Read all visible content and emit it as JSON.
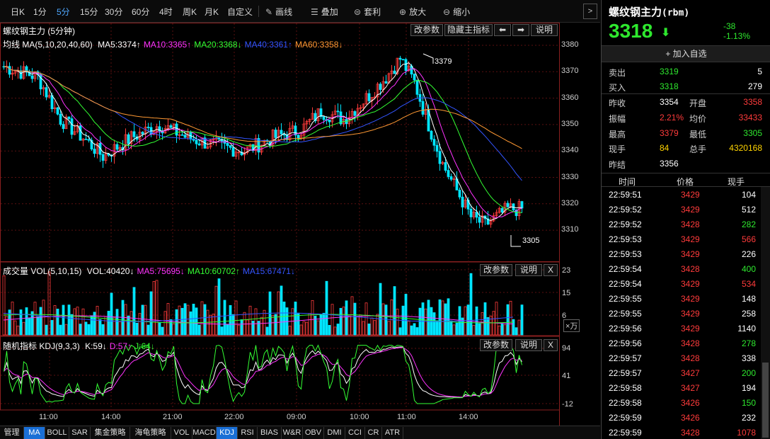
{
  "toolbar": {
    "periods": [
      "日K",
      "1分",
      "5分",
      "15分",
      "30分",
      "60分",
      "4时",
      "周K",
      "月K",
      "自定义"
    ],
    "active_period": "5分",
    "tools": [
      {
        "icon": "pencil-icon",
        "label": "画线"
      },
      {
        "icon": "stack-icon",
        "label": "叠加"
      },
      {
        "icon": "arbitrage-icon",
        "label": "套利"
      },
      {
        "icon": "zoom-in-icon",
        "label": "放大"
      },
      {
        "icon": "zoom-out-icon",
        "label": "缩小"
      }
    ],
    "next_glyph": ">"
  },
  "main_chart": {
    "title": "螺纹钢主力 (5分钟)",
    "buttons": {
      "params": "改参数",
      "hide": "隐藏主指标",
      "left": "⬅",
      "right": "➡",
      "help": "说明"
    },
    "legend": {
      "prefix": "均线",
      "name": "MA(5,10,20,40,60)",
      "items": [
        {
          "text": "MA5:3374↑",
          "color": "#ffffff"
        },
        {
          "text": "MA10:3365↑",
          "color": "#ff33ff"
        },
        {
          "text": "MA20:3368↓",
          "color": "#33ff33"
        },
        {
          "text": "MA40:3361↑",
          "color": "#3355ff"
        },
        {
          "text": "MA60:3358↓",
          "color": "#ff9933"
        }
      ]
    },
    "y_ticks": [
      "3380",
      "3370",
      "3360",
      "3350",
      "3340",
      "3330",
      "3320",
      "3310"
    ],
    "high_mark": "3379",
    "low_mark": "3305"
  },
  "vol_chart": {
    "name": "成交量",
    "params": "VOL(5,10,15)",
    "items": [
      {
        "text": "VOL:40420↓",
        "color": "#ffffff"
      },
      {
        "text": "MA5:75695↓",
        "color": "#ff33ff"
      },
      {
        "text": "MA10:60702↑",
        "color": "#33ff33"
      },
      {
        "text": "MA15:67471↓",
        "color": "#3355ff"
      }
    ],
    "buttons": {
      "params": "改参数",
      "help": "说明",
      "close": "X"
    },
    "y_ticks": [
      "23",
      "15",
      "6"
    ],
    "unit": "×万"
  },
  "kdj_chart": {
    "name": "随机指标",
    "params": "KDJ(9,3,3)",
    "items": [
      {
        "text": "K:59↓",
        "color": "#ffffff"
      },
      {
        "text": "D:57↑",
        "color": "#ff33ff"
      },
      {
        "text": "J:64↓",
        "color": "#33ff33"
      }
    ],
    "buttons": {
      "params": "改参数",
      "help": "说明",
      "close": "X"
    },
    "y_ticks": [
      "94",
      "41",
      "-12"
    ]
  },
  "x_ticks": [
    "11:00",
    "14:00",
    "21:00",
    "22:00",
    "09:00",
    "10:00",
    "11:00",
    "14:00"
  ],
  "tabs": [
    "管理",
    "MA",
    "BOLL",
    "SAR",
    "集金策略",
    "海龟策略",
    "VOL",
    "MACD",
    "KDJ",
    "RSI",
    "BIAS",
    "W&R",
    "OBV",
    "DMI",
    "CCI",
    "CR",
    "ATR"
  ],
  "active_tabs": [
    "MA",
    "KDJ"
  ],
  "quote": {
    "name": "螺纹钢主力",
    "code": "(rbm)",
    "price": "3318",
    "arrow": "⬇",
    "change": "-38",
    "change_pct": "-1.13%",
    "watch_label": "加入自选",
    "sell_label": "卖出",
    "sell_price": "3319",
    "sell_vol": "5",
    "buy_label": "买入",
    "buy_price": "3318",
    "buy_vol": "279",
    "stats": [
      {
        "l1": "昨收",
        "v1": "3354",
        "c1": "white",
        "l2": "开盘",
        "v2": "3358",
        "c2": "red"
      },
      {
        "l1": "振幅",
        "v1": "2.21%",
        "c1": "red",
        "l2": "均价",
        "v2": "33433",
        "c2": "red"
      },
      {
        "l1": "最高",
        "v1": "3379",
        "c1": "red",
        "l2": "最低",
        "v2": "3305",
        "c2": "green"
      },
      {
        "l1": "现手",
        "v1": "84",
        "c1": "yellow",
        "l2": "总手",
        "v2": "4320168",
        "c2": "yellow"
      },
      {
        "l1": "昨结",
        "v1": "3356",
        "c1": "white",
        "l2": "",
        "v2": "",
        "c2": "white"
      }
    ],
    "tick_headers": [
      "时间",
      "价格",
      "现手"
    ],
    "ticks": [
      {
        "t": "22:59:51",
        "p": "3429",
        "v": "104",
        "vc": "white"
      },
      {
        "t": "22:59:52",
        "p": "3429",
        "v": "512",
        "vc": "white"
      },
      {
        "t": "22:59:52",
        "p": "3428",
        "v": "282",
        "vc": "green"
      },
      {
        "t": "22:59:53",
        "p": "3429",
        "v": "566",
        "vc": "red"
      },
      {
        "t": "22:59:53",
        "p": "3429",
        "v": "226",
        "vc": "white"
      },
      {
        "t": "22:59:54",
        "p": "3428",
        "v": "400",
        "vc": "green"
      },
      {
        "t": "22:59:54",
        "p": "3429",
        "v": "534",
        "vc": "red"
      },
      {
        "t": "22:59:55",
        "p": "3429",
        "v": "148",
        "vc": "white"
      },
      {
        "t": "22:59:55",
        "p": "3429",
        "v": "258",
        "vc": "white"
      },
      {
        "t": "22:59:56",
        "p": "3429",
        "v": "1140",
        "vc": "white"
      },
      {
        "t": "22:59:56",
        "p": "3428",
        "v": "278",
        "vc": "green"
      },
      {
        "t": "22:59:57",
        "p": "3428",
        "v": "338",
        "vc": "white"
      },
      {
        "t": "22:59:57",
        "p": "3427",
        "v": "200",
        "vc": "green"
      },
      {
        "t": "22:59:58",
        "p": "3427",
        "v": "194",
        "vc": "white"
      },
      {
        "t": "22:59:58",
        "p": "3426",
        "v": "150",
        "vc": "green"
      },
      {
        "t": "22:59:59",
        "p": "3426",
        "v": "232",
        "vc": "white"
      },
      {
        "t": "22:59:59",
        "p": "3428",
        "v": "1078",
        "vc": "red"
      }
    ]
  }
}
